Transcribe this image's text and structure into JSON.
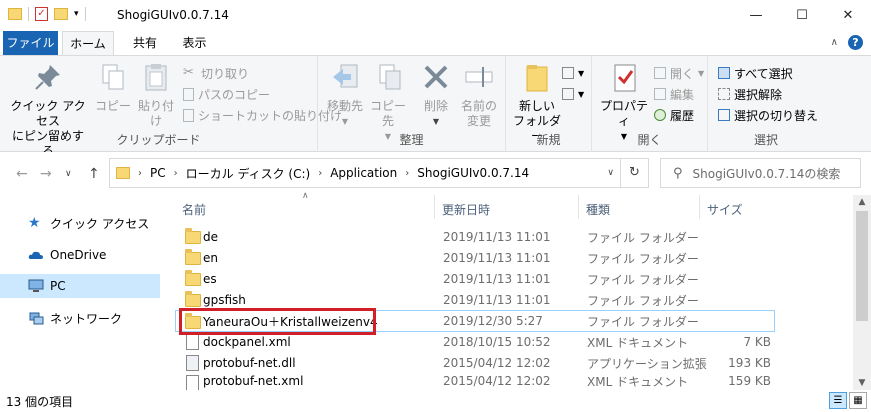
{
  "window": {
    "title": "ShogiGUIv0.0.7.14"
  },
  "tabs": {
    "file": "ファイル",
    "home": "ホーム",
    "share": "共有",
    "view": "表示"
  },
  "ribbon": {
    "clipboard": {
      "label": "クリップボード",
      "pin": {
        "line1": "クイック アクセス",
        "line2": "にピン留めする"
      },
      "copy": "コピー",
      "paste": "貼り付け",
      "cut": "切り取り",
      "copy_path": "パスのコピー",
      "paste_shortcut": "ショートカットの貼り付け"
    },
    "organize": {
      "label": "整理",
      "move_to": "移動先",
      "copy_to": "コピー先",
      "delete": "削除",
      "rename": {
        "line1": "名前の",
        "line2": "変更"
      }
    },
    "new": {
      "label": "新規",
      "new_folder": {
        "line1": "新しい",
        "line2": "フォルダー"
      }
    },
    "open": {
      "label": "開く",
      "properties": "プロパティ",
      "open": "開く",
      "edit": "編集",
      "history": "履歴"
    },
    "select": {
      "label": "選択",
      "select_all": "すべて選択",
      "select_none": "選択解除",
      "invert": "選択の切り替え"
    }
  },
  "address": {
    "crumbs": [
      "PC",
      "ローカル ディスク (C:)",
      "Application",
      "ShogiGUIv0.0.7.14"
    ],
    "search_placeholder": "ShogiGUIv0.0.7.14の検索"
  },
  "nav": {
    "quick_access": "クイック アクセス",
    "onedrive": "OneDrive",
    "pc": "PC",
    "network": "ネットワーク"
  },
  "columns": {
    "name": "名前",
    "date": "更新日時",
    "type": "種類",
    "size": "サイズ"
  },
  "files": [
    {
      "name": "de",
      "date": "2019/11/13 11:01",
      "type": "ファイル フォルダー",
      "size": "",
      "kind": "folder"
    },
    {
      "name": "en",
      "date": "2019/11/13 11:01",
      "type": "ファイル フォルダー",
      "size": "",
      "kind": "folder"
    },
    {
      "name": "es",
      "date": "2019/11/13 11:01",
      "type": "ファイル フォルダー",
      "size": "",
      "kind": "folder"
    },
    {
      "name": "gpsfish",
      "date": "2019/11/13 11:01",
      "type": "ファイル フォルダー",
      "size": "",
      "kind": "folder"
    },
    {
      "name": "YaneuraOu＋Kristallweizenv4",
      "date": "2019/12/30 5:27",
      "type": "ファイル フォルダー",
      "size": "",
      "kind": "folder"
    },
    {
      "name": "dockpanel.xml",
      "date": "2018/10/15 10:52",
      "type": "XML ドキュメント",
      "size": "7 KB",
      "kind": "doc"
    },
    {
      "name": "protobuf-net.dll",
      "date": "2015/04/12 12:02",
      "type": "アプリケーション拡張",
      "size": "193 KB",
      "kind": "doc"
    },
    {
      "name": "protobuf-net.xml",
      "date": "2015/04/12 12:02",
      "type": "XML ドキュメント",
      "size": "159 KB",
      "kind": "doc"
    }
  ],
  "status": {
    "count": "13 個の項目"
  },
  "colors": {
    "accent": "#1a64b4",
    "highlight": "#d01f26",
    "folder": "#f8d775",
    "selection": "#cce8ff"
  }
}
